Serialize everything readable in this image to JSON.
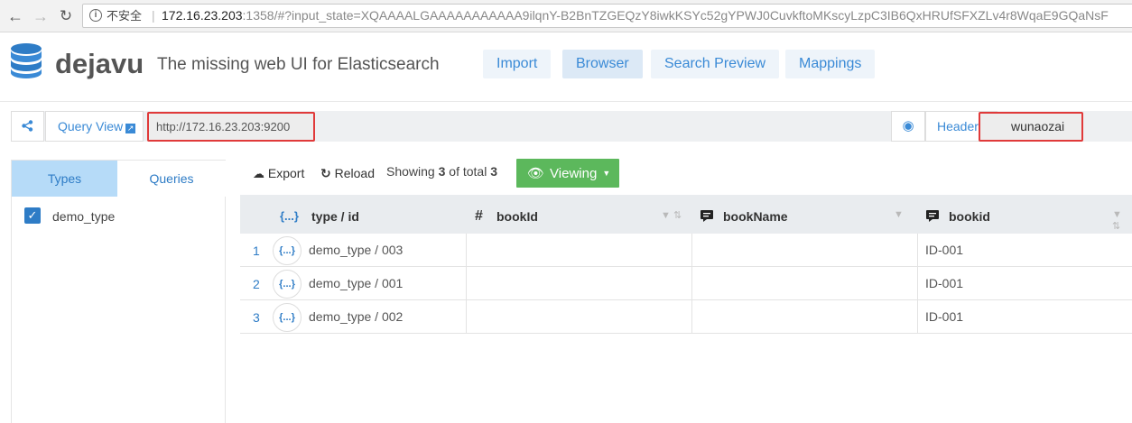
{
  "browser": {
    "insecure_label": "不安全",
    "url_host": "172.16.23.203",
    "url_rest": ":1358/#?input_state=XQAAAALGAAAAAAAAAAA9ilqnY-B2BnTZGEQzY8iwkKSYc52gYPWJ0CuvkftoMKscyLzpC3IB6QxHRUfSFXZLv4r8WqaE9GQaNsF"
  },
  "header": {
    "brand": "dejavu",
    "tagline": "The missing web UI for Elasticsearch",
    "tabs": [
      {
        "label": "Import"
      },
      {
        "label": "Browser"
      },
      {
        "label": "Search Preview"
      },
      {
        "label": "Mappings"
      }
    ],
    "active_tab": "Browser"
  },
  "connection": {
    "query_view_label": "Query View",
    "url_value": "http://172.16.23.203:9200",
    "headers_label": "Headers",
    "index_value": "wunaozai"
  },
  "sidebar": {
    "tabs": [
      {
        "label": "Types"
      },
      {
        "label": "Queries"
      }
    ],
    "types": [
      {
        "label": "demo_type",
        "checked": true
      }
    ]
  },
  "toolbar": {
    "export_label": "Export",
    "reload_label": "Reload",
    "showing_prefix": "Showing ",
    "showing_count": "3",
    "showing_mid": " of total ",
    "showing_total": "3",
    "viewing_label": "Viewing"
  },
  "table": {
    "columns": [
      {
        "icon": "{...}",
        "label": "type / id"
      },
      {
        "icon": "#",
        "label": "bookId"
      },
      {
        "icon": "comment",
        "label": "bookName"
      },
      {
        "icon": "comment",
        "label": "bookid"
      }
    ],
    "rows": [
      {
        "num": "1",
        "json": "{...}",
        "type_id": "demo_type / 003",
        "bookId": "",
        "bookName": "",
        "bookid": "ID-001"
      },
      {
        "num": "2",
        "json": "{...}",
        "type_id": "demo_type / 001",
        "bookId": "",
        "bookName": "",
        "bookid": "ID-001"
      },
      {
        "num": "3",
        "json": "{...}",
        "type_id": "demo_type / 002",
        "bookId": "",
        "bookName": "",
        "bookid": "ID-001"
      }
    ]
  },
  "colors": {
    "accent": "#3a8ad6",
    "viewing_green": "#5cb85c",
    "highlight_red": "#e03a3a",
    "types_tab_bg": "#b6dbf8"
  }
}
